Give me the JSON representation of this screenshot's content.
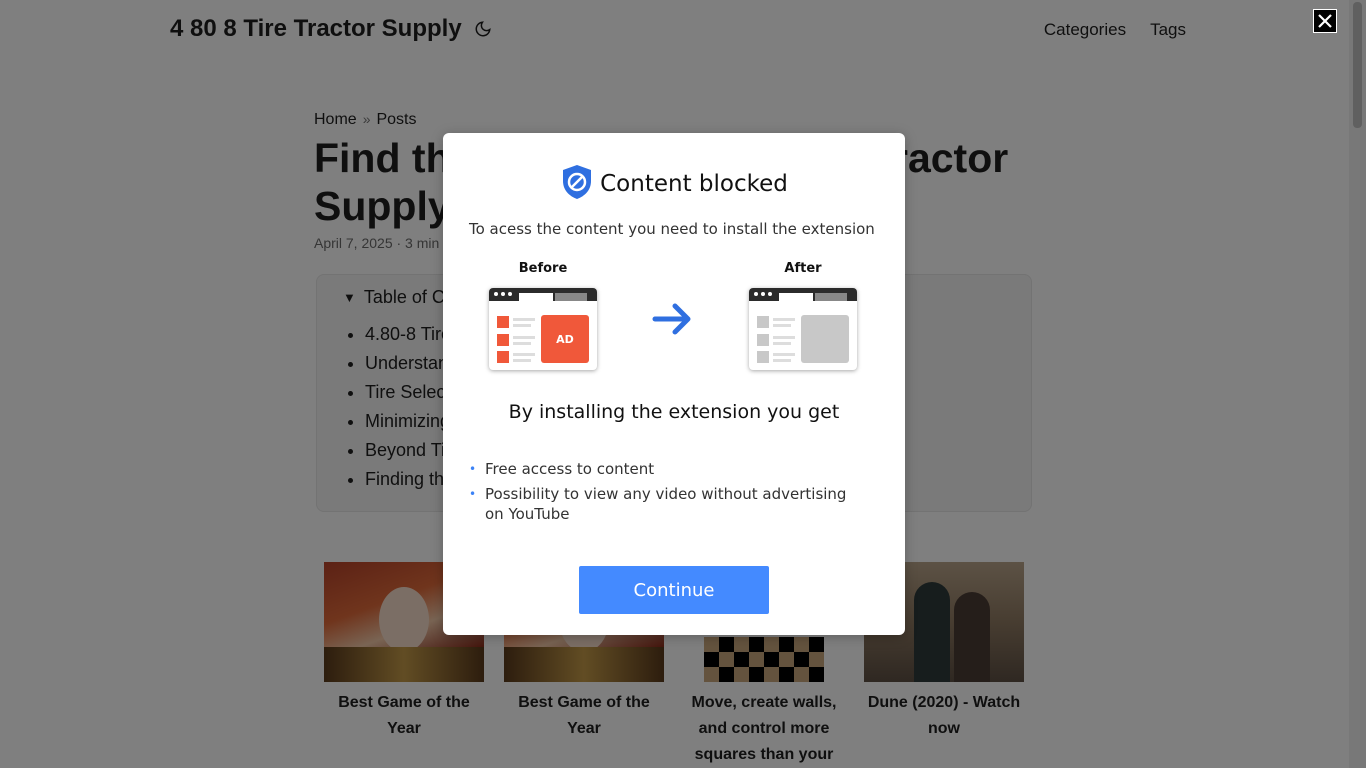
{
  "header": {
    "logo": "4 80 8 Tire Tractor Supply",
    "theme_icon": "moon-icon",
    "nav": [
      "Categories",
      "Tags"
    ]
  },
  "breadcrumb": [
    "Home",
    "Posts"
  ],
  "breadcrumb_sep": "»",
  "post": {
    "title": "Find the Best 4.80-8 Tires at Tractor Supply",
    "meta": "April 7, 2025 · 3 min"
  },
  "toc": {
    "summary": "Table of Contents",
    "items": [
      "4.80-8 Tires",
      "Understanding",
      "Tire Selection",
      "Minimizing",
      "Beyond Tires",
      "Finding the"
    ]
  },
  "cards": [
    {
      "title": "Best Game of the Year",
      "image": "fantasy-warrior-image"
    },
    {
      "title": "Best Game of the Year",
      "image": "fantasy-warrior-image"
    },
    {
      "title": "Move, create walls, and control more squares than your",
      "image": "board-game-image"
    },
    {
      "title": "Dune (2020) - Watch now",
      "image": "dune-poster-image"
    }
  ],
  "modal": {
    "title": "Content blocked",
    "subtitle": "To acess the content you need to install the extension",
    "before_label": "Before",
    "after_label": "After",
    "ad_label": "AD",
    "benefits_title": "By installing the extension you get",
    "benefits": [
      "Free access to content",
      "Possibility to view any video without advertising on YouTube"
    ],
    "continue_label": "Continue",
    "accent_color": "#448aff",
    "ad_color": "#f0583a",
    "shield_color": "#2f6fe0"
  },
  "close_icon": "close-icon"
}
